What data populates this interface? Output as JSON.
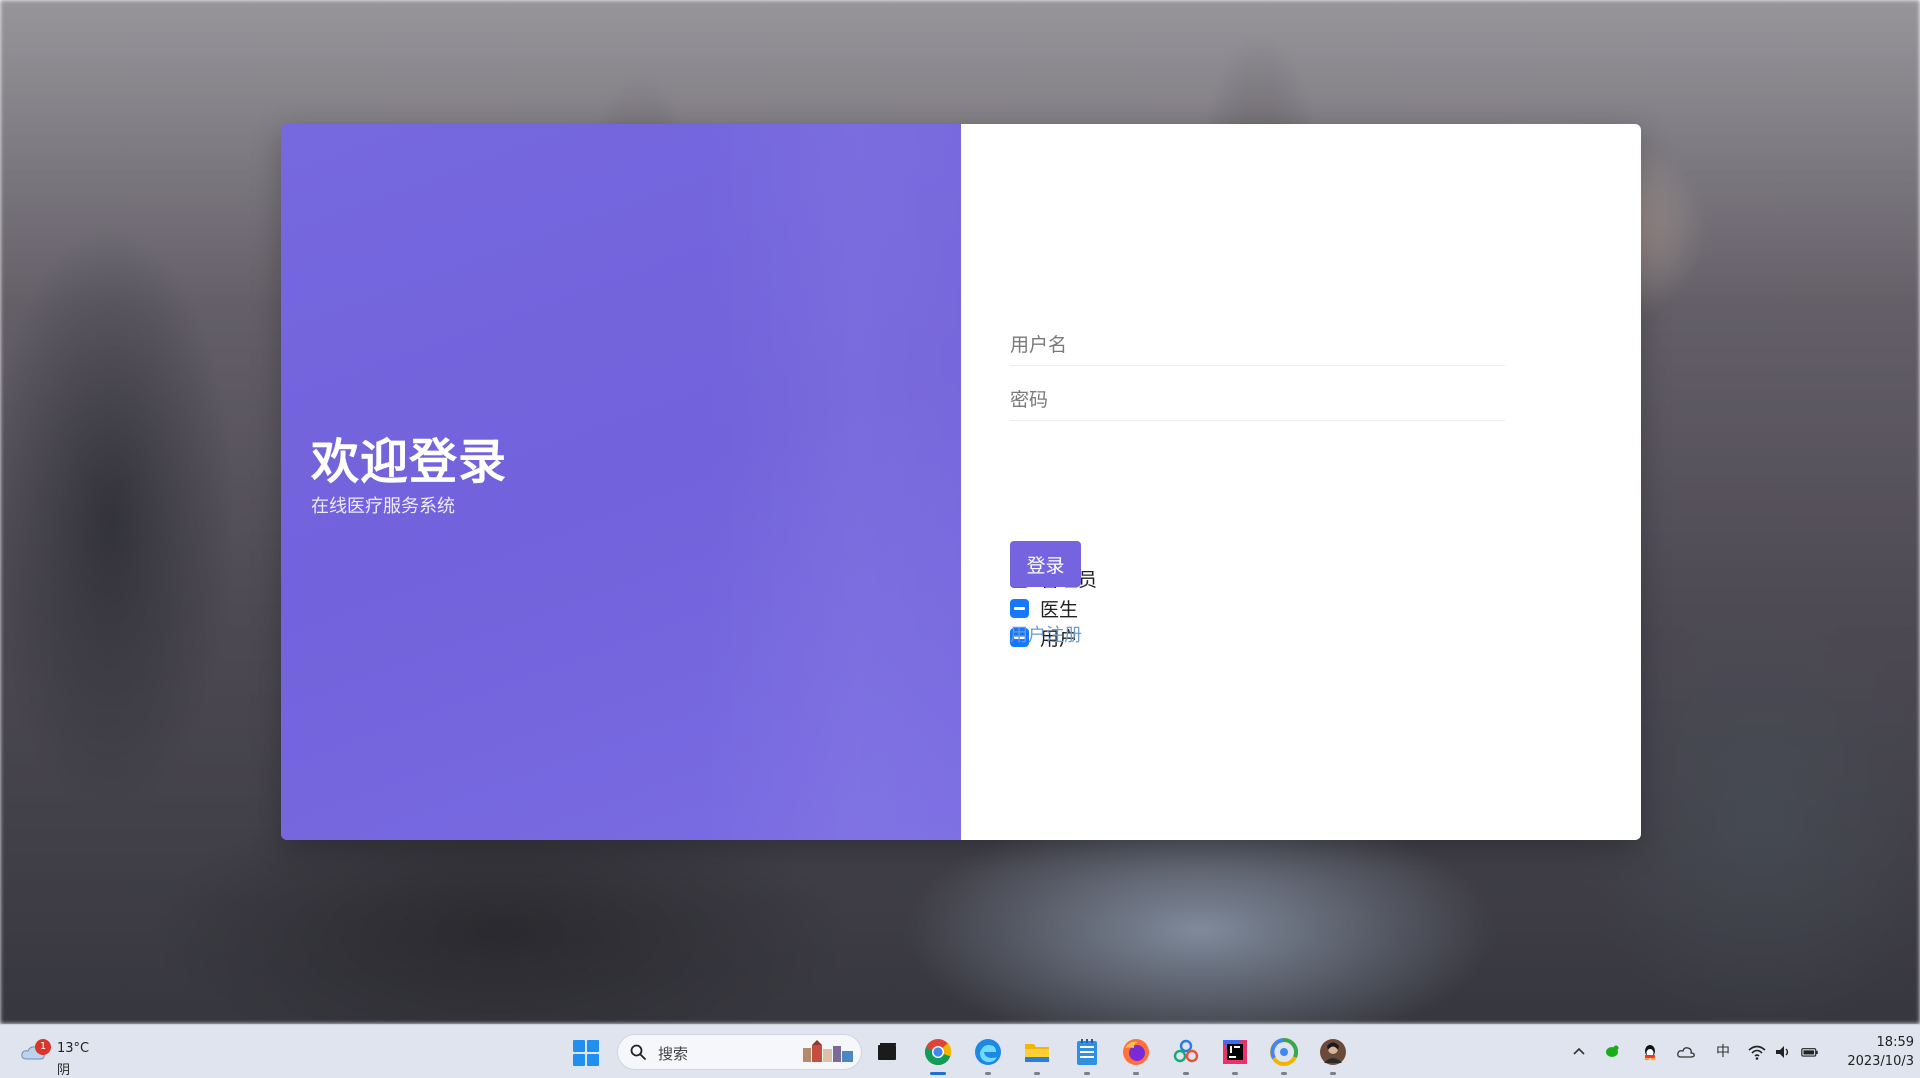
{
  "login": {
    "title": "欢迎登录",
    "subtitle": "在线医疗服务系统",
    "username_placeholder": "用户名",
    "password_placeholder": "密码",
    "roles": [
      {
        "label": "管理员",
        "checked": "indeterminate"
      },
      {
        "label": "医生",
        "checked": "indeterminate"
      },
      {
        "label": "用户",
        "checked": "indeterminate"
      }
    ],
    "login_button": "登录",
    "register_link": "用户注册"
  },
  "colors": {
    "left_panel": "#7466df",
    "login_button": "#7464e0",
    "checkbox": "#1677ff",
    "register_link": "#6d9bd0"
  },
  "taskbar": {
    "weather": {
      "temperature": "13°C",
      "condition": "阴",
      "badge_count": "1",
      "icon": "cloud-icon"
    },
    "search_placeholder": "搜索",
    "apps": [
      {
        "name": "start-menu",
        "icon": "windows-icon"
      },
      {
        "name": "task-view",
        "icon": "task-view-icon"
      },
      {
        "name": "chrome",
        "icon": "chrome-icon",
        "active": true
      },
      {
        "name": "edge",
        "icon": "edge-icon"
      },
      {
        "name": "file-explorer",
        "icon": "folder-icon"
      },
      {
        "name": "notepad",
        "icon": "notepad-icon"
      },
      {
        "name": "firefox",
        "icon": "firefox-icon"
      },
      {
        "name": "network-app",
        "icon": "network-icon"
      },
      {
        "name": "jetbrains-ide",
        "icon": "ide-icon"
      },
      {
        "name": "chrome-canary",
        "icon": "browser-icon"
      },
      {
        "name": "avatar-app",
        "icon": "avatar-icon"
      }
    ],
    "tray": {
      "icons": [
        "chevron-up-icon",
        "wechat-icon",
        "qq-icon",
        "onedrive-icon",
        "ime-icon",
        "wifi-icon",
        "volume-icon",
        "battery-icon"
      ],
      "ime_label": "中"
    },
    "clock": {
      "time": "18:59",
      "date": "2023/10/3"
    }
  }
}
